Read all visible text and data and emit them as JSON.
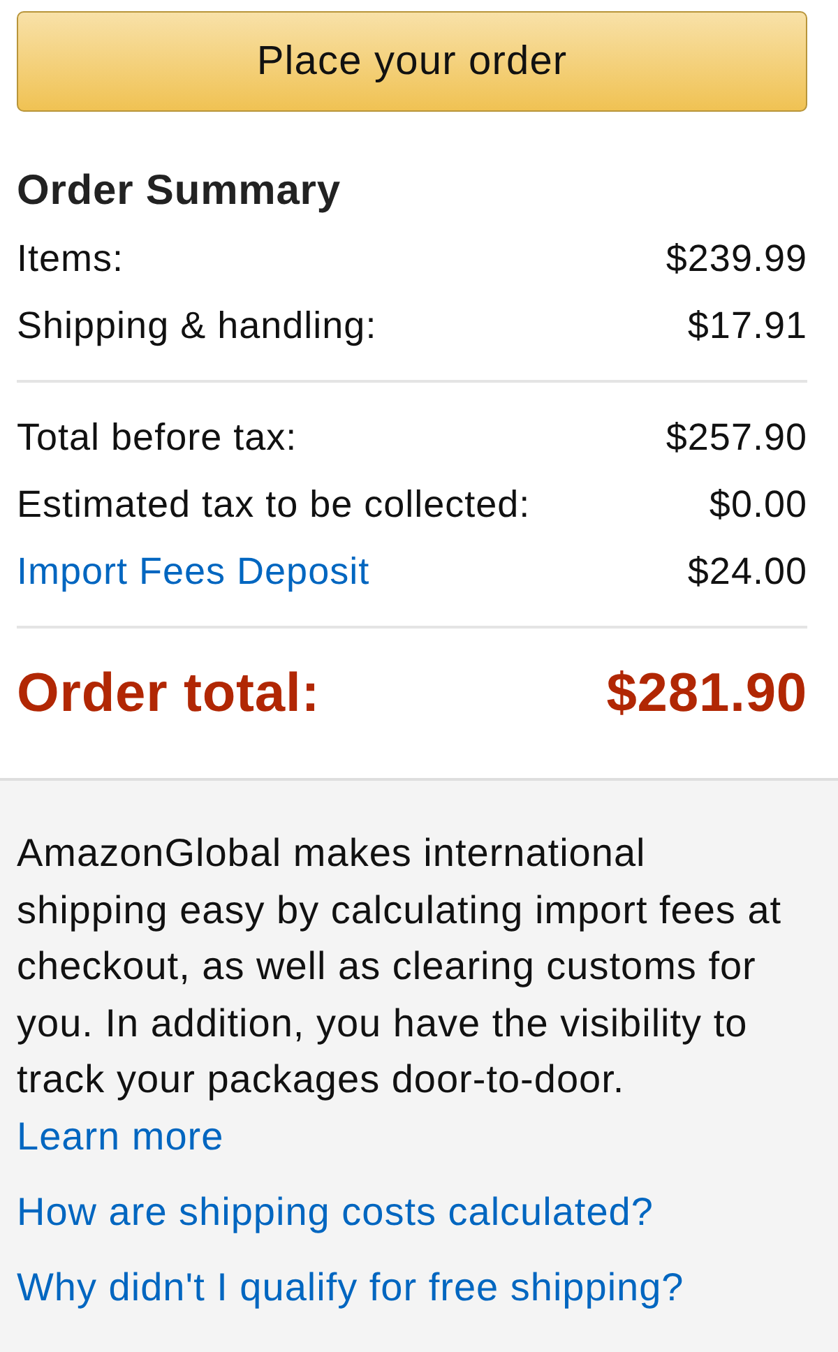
{
  "button": {
    "label": "Place your order"
  },
  "summary": {
    "title": "Order Summary",
    "groups": [
      [
        {
          "kind": "text",
          "label": "Items:",
          "amount": "$239.99"
        },
        {
          "kind": "text",
          "label": "Shipping & handling:",
          "amount": "$17.91"
        }
      ],
      [
        {
          "kind": "text",
          "label": "Total before tax:",
          "amount": "$257.90"
        },
        {
          "kind": "text",
          "label": "Estimated tax to be collected:",
          "amount": "$0.00"
        },
        {
          "kind": "link",
          "label": "Import Fees Deposit",
          "amount": "$24.00"
        }
      ]
    ],
    "total": {
      "label": "Order total:",
      "amount": "$281.90"
    }
  },
  "info": {
    "paragraph": {
      "text": "AmazonGlobal makes international shipping easy by calculating import fees at checkout, as well as clearing customs for you. In addition, you have the visibility to track your packages door-to-door.",
      "link": "Learn more"
    },
    "links": [
      "How are shipping costs calculated?",
      "Why didn't I qualify for free shipping?"
    ]
  }
}
